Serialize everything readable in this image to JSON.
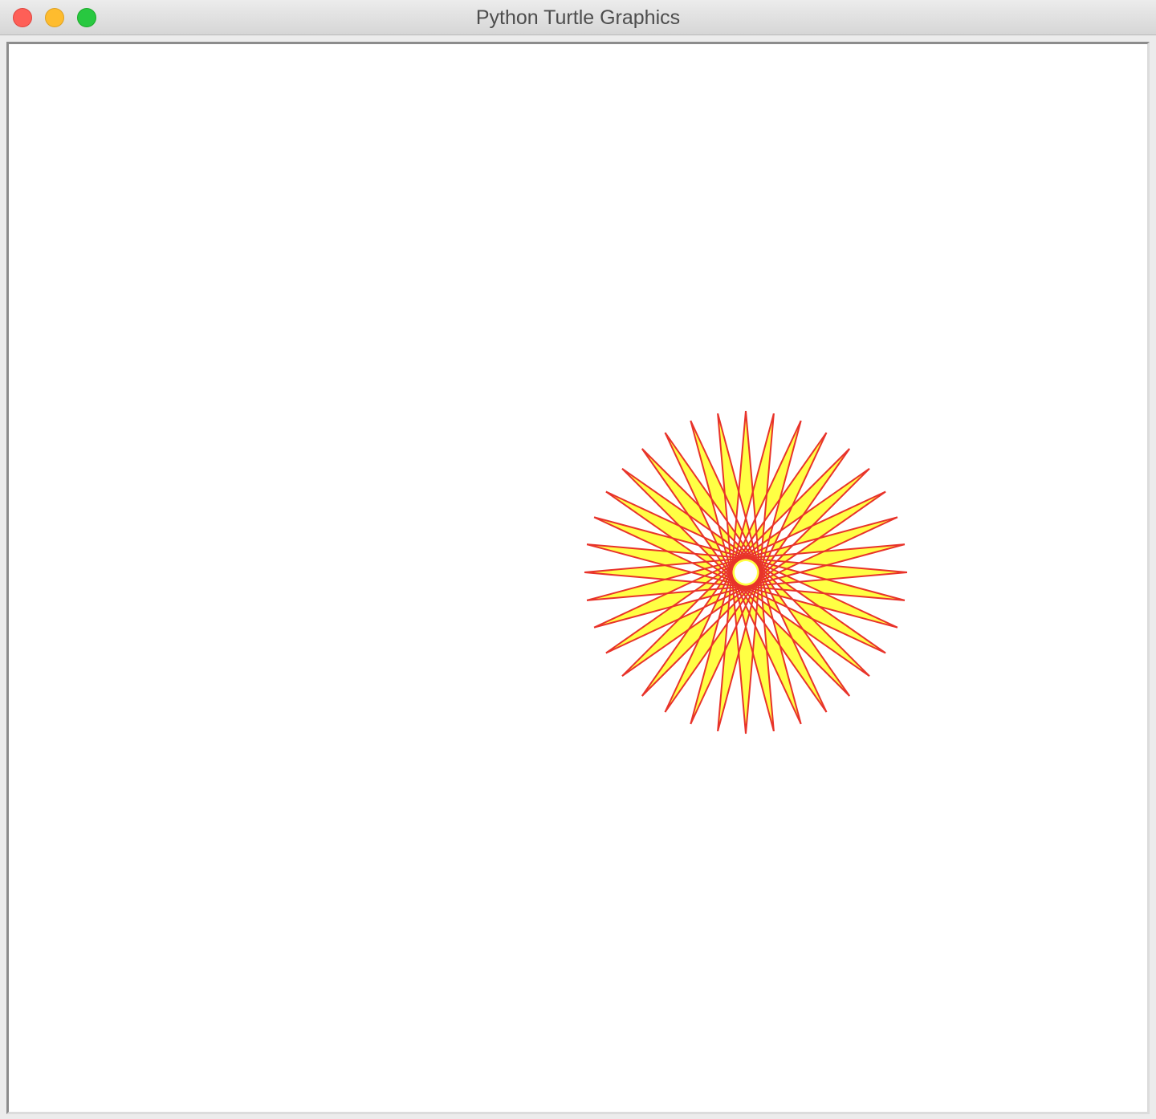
{
  "window": {
    "title": "Python Turtle Graphics",
    "controls": {
      "close_icon": "close-icon",
      "minimize_icon": "minimize-icon",
      "zoom_icon": "zoom-icon",
      "close_color": "#fe5f57",
      "minimize_color": "#febc2e",
      "zoom_color": "#28c840"
    }
  },
  "canvas": {
    "background": "#ffffff",
    "drawing": {
      "shape": "star",
      "points": 36,
      "pen_color": "#e8332a",
      "fill_color": "#ffff44"
    }
  }
}
